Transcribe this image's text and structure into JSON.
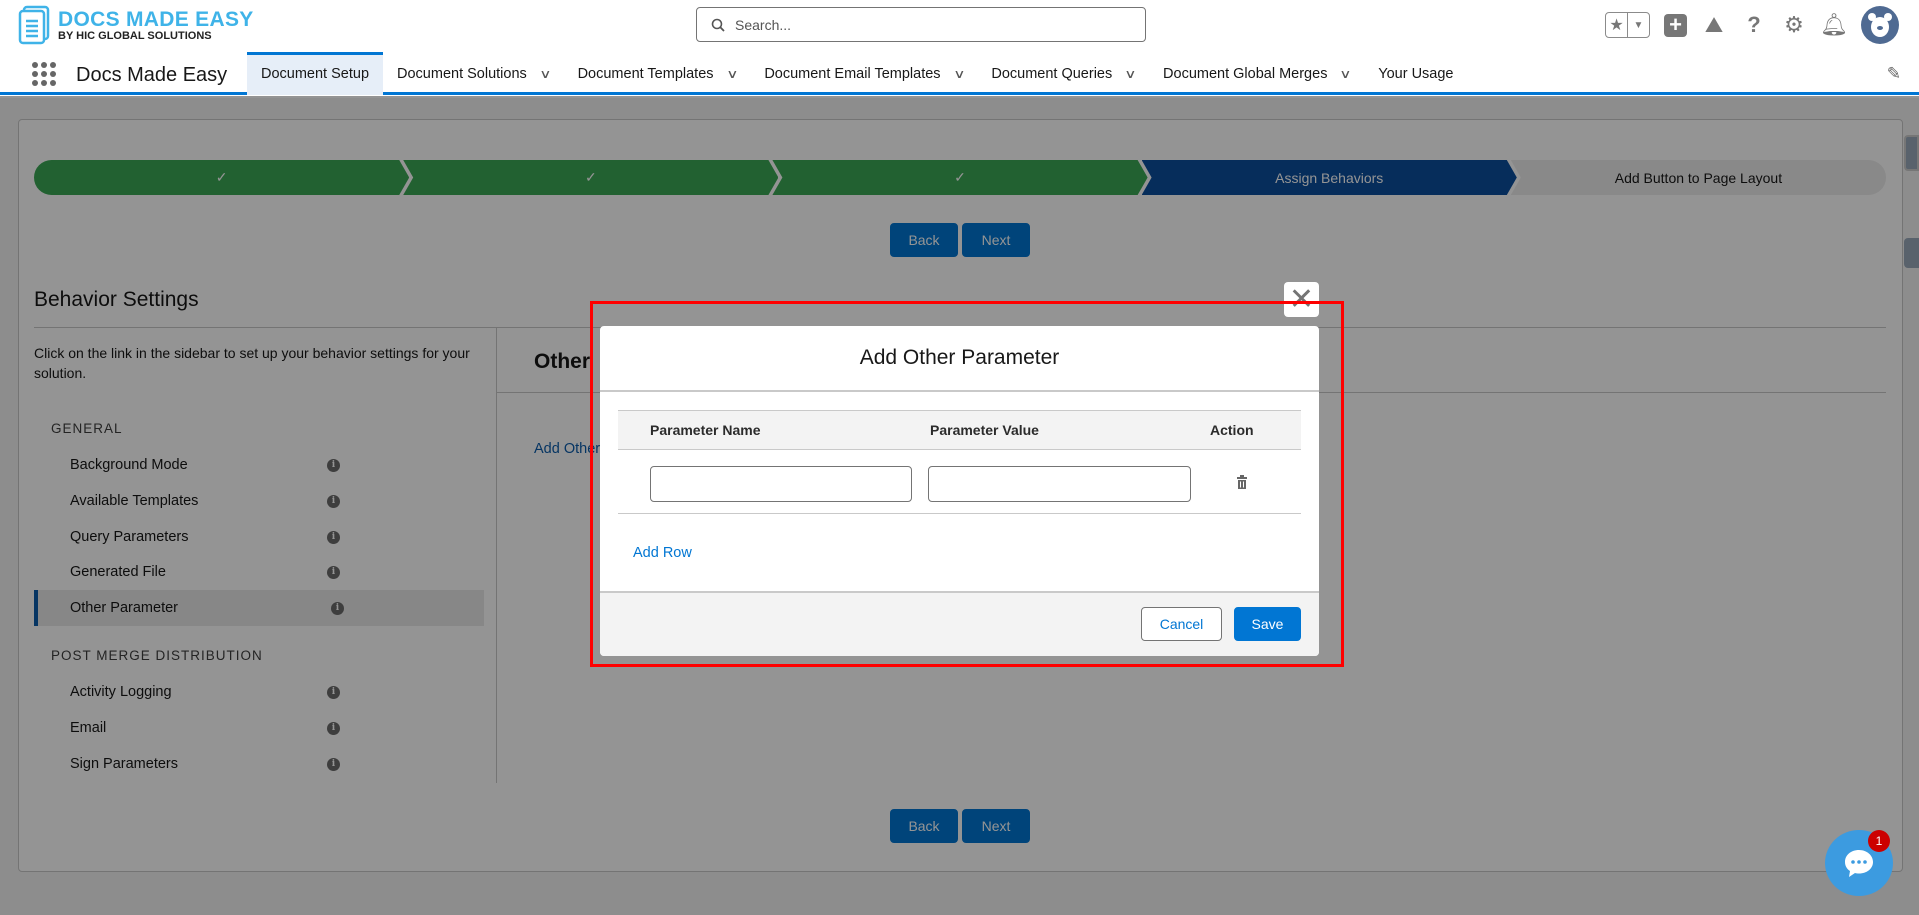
{
  "header": {
    "logo_title": "DOCS MADE EASY",
    "logo_subtitle": "BY HIC GLOBAL SOLUTIONS",
    "search_placeholder": "Search...",
    "app_name": "Docs Made Easy",
    "notification_count": "1"
  },
  "nav": {
    "tabs": [
      {
        "label": "Document Setup",
        "active": true
      },
      {
        "label": "Document Solutions",
        "dropdown": true
      },
      {
        "label": "Document Templates",
        "dropdown": true
      },
      {
        "label": "Document Email Templates",
        "dropdown": true
      },
      {
        "label": "Document Queries",
        "dropdown": true
      },
      {
        "label": "Document Global Merges",
        "dropdown": true
      },
      {
        "label": "Your Usage"
      }
    ]
  },
  "path": {
    "steps": [
      {
        "label": "✓",
        "status": "complete"
      },
      {
        "label": "✓",
        "status": "complete"
      },
      {
        "label": "✓",
        "status": "complete"
      },
      {
        "label": "Assign Behaviors",
        "status": "current"
      },
      {
        "label": "Add Button to Page Layout",
        "status": "incomplete"
      }
    ],
    "back_label": "Back",
    "next_label": "Next"
  },
  "behavior": {
    "title": "Behavior Settings",
    "description": "Click on the link in the sidebar to set up your behavior settings for your solution.",
    "sections": [
      {
        "label": "GENERAL",
        "items": [
          "Background Mode",
          "Available Templates",
          "Query Parameters",
          "Generated File",
          "Other Parameter"
        ]
      },
      {
        "label": "POST MERGE DISTRIBUTION",
        "items": [
          "Activity Logging",
          "Email",
          "Sign Parameters"
        ]
      }
    ],
    "selected_item": "Other Parameter",
    "panel_title": "Other",
    "panel_link": "Add Other"
  },
  "modal": {
    "title": "Add Other Parameter",
    "columns": [
      "Parameter Name",
      "Parameter Value",
      "Action"
    ],
    "rows": [
      {
        "name": "",
        "value": ""
      }
    ],
    "add_row_label": "Add Row",
    "cancel_label": "Cancel",
    "save_label": "Save"
  },
  "colors": {
    "brand": "#0176d3",
    "complete": "#3ba755",
    "current": "#0b4e9e",
    "highlight": "#ff0000"
  }
}
